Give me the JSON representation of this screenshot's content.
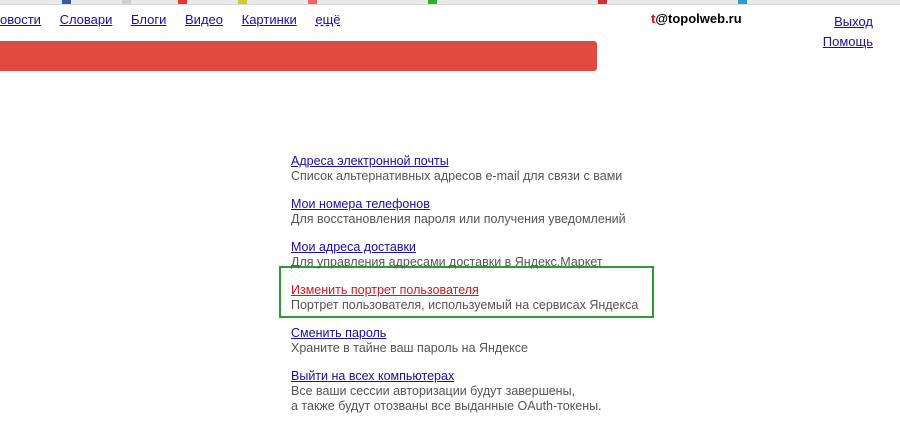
{
  "colors": {
    "link": "#1a0dab",
    "active_link": "#e0131a",
    "header_bar": "#e14a3e",
    "highlight_border": "#2c9a3a"
  },
  "services": [
    "овости",
    "Словари",
    "Блоги",
    "Видео",
    "Картинки",
    "ещё"
  ],
  "user": {
    "first_letter": "t",
    "rest": "@topolweb.ru"
  },
  "account": {
    "logout": "Выход",
    "help": "Помощь"
  },
  "menu": [
    {
      "link": "Адреса электронной почты",
      "desc": "Список альтернативных адресов e-mail для связи с вами"
    },
    {
      "link": "Мои номера телефонов",
      "desc": "Для восстановления пароля или получения уведомлений"
    },
    {
      "link": "Мои адреса доставки",
      "desc": "Для управления адресами доставки в Яндекс.Маркет"
    },
    {
      "link": "Изменить портрет пользователя",
      "desc": "Портрет пользователя, используемый на сервисах Яндекса"
    },
    {
      "link": "Сменить пароль",
      "desc": "Храните в тайне ваш пароль на Яндексе"
    },
    {
      "link": "Выйти на всех компьютерах",
      "desc": "Все ваши сессии авторизации будут завершены,",
      "desc2": "а также будут отозваны все выданные OAuth-токены."
    }
  ]
}
